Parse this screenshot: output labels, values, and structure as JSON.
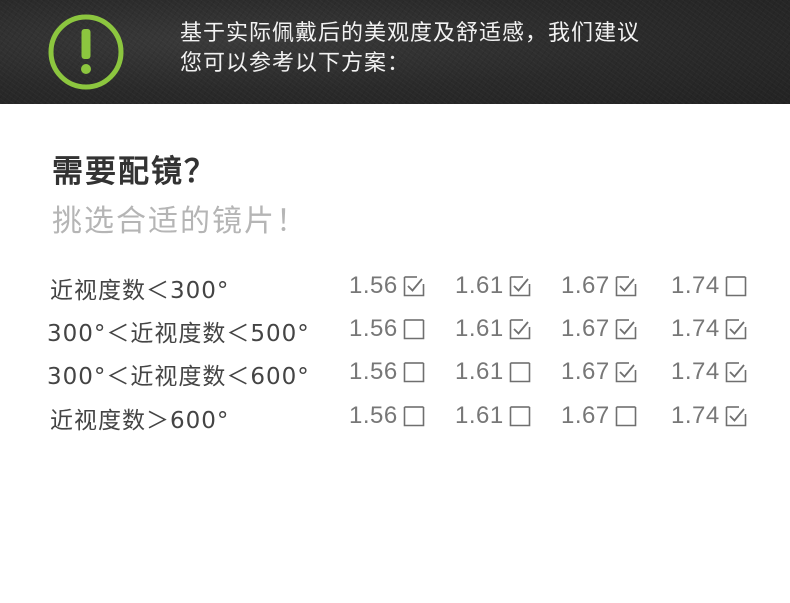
{
  "banner": {
    "icon": "exclamation-circle-icon",
    "accent": "#8cc63f",
    "line1": "基于实际佩戴后的美观度及舒适感，我们建议",
    "line2": "您可以参考以下方案："
  },
  "heading": {
    "title": "需要配镜？",
    "subtitle": "挑选合适的镜片！"
  },
  "rows": [
    {
      "label": "近视度数＜300°",
      "options": [
        {
          "value": "1.56",
          "checked": true
        },
        {
          "value": "1.61",
          "checked": true
        },
        {
          "value": "1.67",
          "checked": true
        },
        {
          "value": "1.74",
          "checked": false
        }
      ]
    },
    {
      "label": "300°＜近视度数＜500°",
      "options": [
        {
          "value": "1.56",
          "checked": false
        },
        {
          "value": "1.61",
          "checked": true
        },
        {
          "value": "1.67",
          "checked": true
        },
        {
          "value": "1.74",
          "checked": true
        }
      ]
    },
    {
      "label": "300°＜近视度数＜600°",
      "options": [
        {
          "value": "1.56",
          "checked": false
        },
        {
          "value": "1.61",
          "checked": false
        },
        {
          "value": "1.67",
          "checked": true
        },
        {
          "value": "1.74",
          "checked": true
        }
      ]
    },
    {
      "label": "近视度数＞600°",
      "options": [
        {
          "value": "1.56",
          "checked": false
        },
        {
          "value": "1.61",
          "checked": false
        },
        {
          "value": "1.67",
          "checked": false
        },
        {
          "value": "1.74",
          "checked": true
        }
      ]
    }
  ]
}
